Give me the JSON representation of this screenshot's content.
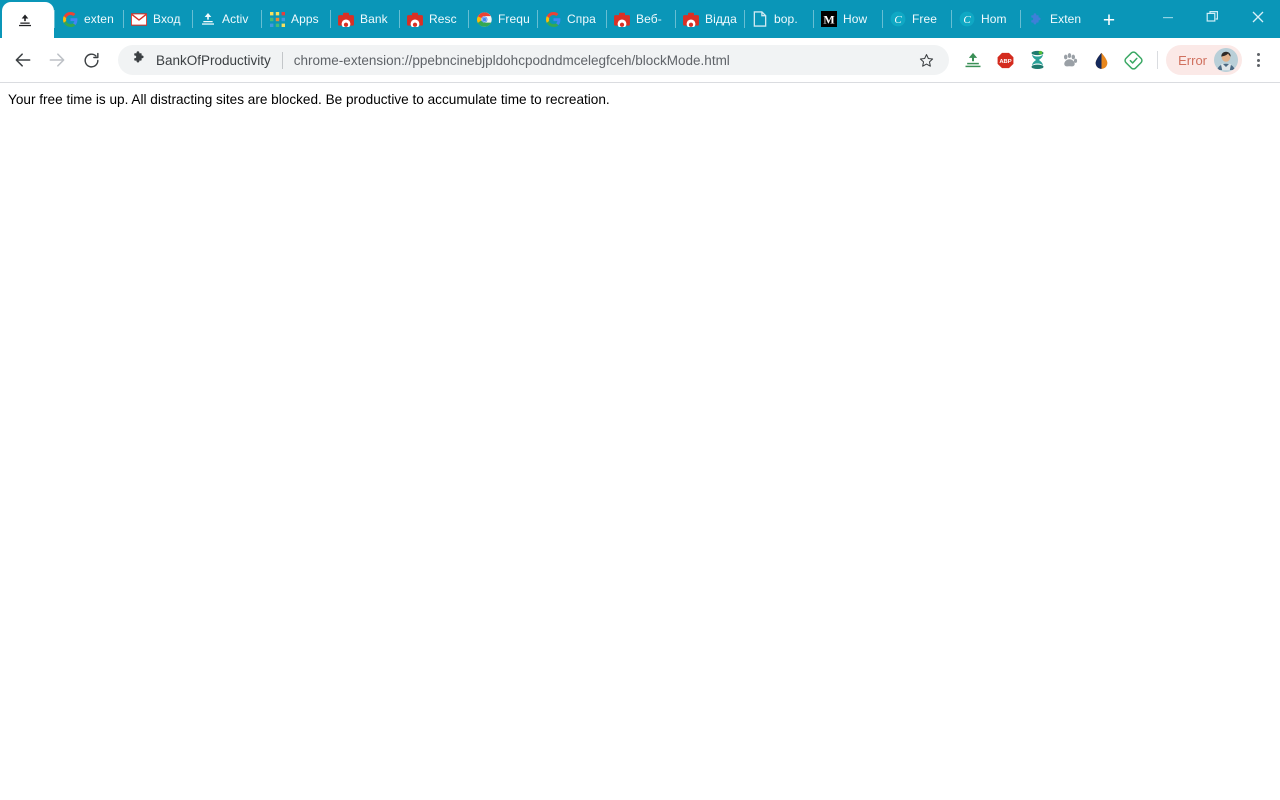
{
  "window": {
    "controls": [
      {
        "name": "minimize",
        "glyph": "–"
      },
      {
        "name": "restore",
        "glyph": "❐"
      },
      {
        "name": "close",
        "glyph": "✕"
      }
    ]
  },
  "tabstrip": {
    "active_tab": {
      "title": "",
      "favicon": "upload-icon"
    },
    "tabs": [
      {
        "title": "exten",
        "favicon": "google-icon"
      },
      {
        "title": "Вход",
        "favicon": "gmail-icon"
      },
      {
        "title": "Activ",
        "favicon": "upload-icon"
      },
      {
        "title": "Apps",
        "favicon": "apps-grid-icon"
      },
      {
        "title": "Bank",
        "favicon": "chrome-webstore-icon"
      },
      {
        "title": "Resc",
        "favicon": "chrome-webstore-icon"
      },
      {
        "title": "Frequ",
        "favicon": "chrome-icon"
      },
      {
        "title": "Спра",
        "favicon": "google-icon"
      },
      {
        "title": "Веб-",
        "favicon": "chrome-webstore-icon"
      },
      {
        "title": "Відда",
        "favicon": "chrome-webstore-icon"
      },
      {
        "title": "bop.",
        "favicon": "document-icon"
      },
      {
        "title": "How",
        "favicon": "medium-icon"
      },
      {
        "title": "Free",
        "favicon": "coursera-icon"
      },
      {
        "title": "Hom",
        "favicon": "coursera-icon"
      },
      {
        "title": "Exten",
        "favicon": "puzzle-piece-icon"
      }
    ],
    "new_tab_label": "+"
  },
  "toolbar": {
    "back_label": "←",
    "forward_label": "→",
    "reload_label": "⟳",
    "extension_name": "BankOfProductivity",
    "url": "chrome-extension://ppebncinebjpldohcpodndmcelegfceh/blockMode.html",
    "star_label": "☆",
    "extension_icons": [
      {
        "name": "upload-icon",
        "title": "Upload"
      },
      {
        "name": "adblock-plus-icon",
        "title": "ABP"
      },
      {
        "name": "hourglass-icon",
        "title": "Hourglass"
      },
      {
        "name": "paw-icon",
        "title": "Paw"
      },
      {
        "name": "droplet-icon",
        "title": "Droplet"
      },
      {
        "name": "checkmark-diamond-icon",
        "title": "Checkmark"
      }
    ],
    "profile_status": "Error",
    "menu_label": "⋮"
  },
  "page": {
    "message": "Your free time is up. All distracting sites are blocked. Be productive to accumulate time to recreation."
  },
  "colors": {
    "titlebar": "#0a96b8",
    "omnibox": "#f1f3f4",
    "profile_pill": "#fbe9e7",
    "error_text": "#d0705e",
    "page_background": "#ffffff"
  }
}
